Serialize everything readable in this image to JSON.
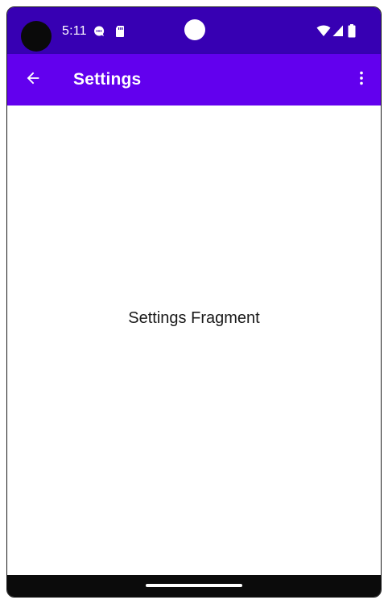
{
  "status_bar": {
    "time": "5:11",
    "icons": [
      "camera-hole",
      "notification-chat-icon",
      "sd-card-icon",
      "wifi-icon",
      "cellular-signal-icon",
      "battery-icon"
    ]
  },
  "app_bar": {
    "title": "Settings",
    "back_icon": "arrow-back-icon",
    "overflow_icon": "more-vert-icon"
  },
  "content": {
    "message": "Settings Fragment"
  },
  "colors": {
    "status_bar": "#3700b3",
    "app_bar": "#6200ee",
    "background": "#ffffff",
    "nav_bar": "#0b0b0b",
    "text": "#1a1a1a"
  }
}
